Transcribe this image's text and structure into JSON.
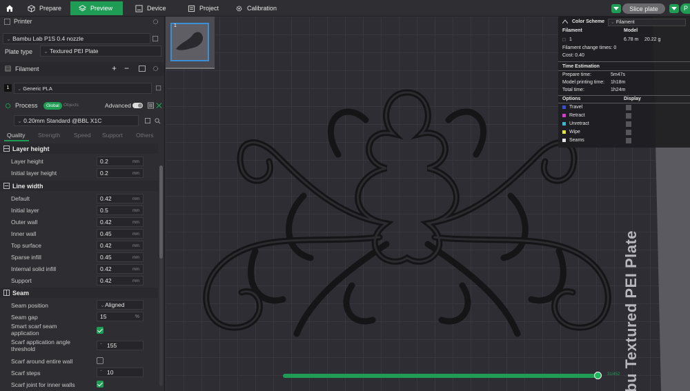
{
  "topbar": {
    "tabs": [
      {
        "label": "Prepare"
      },
      {
        "label": "Preview"
      },
      {
        "label": "Device"
      },
      {
        "label": "Project"
      },
      {
        "label": "Calibration"
      }
    ],
    "slice_label": "Slice plate",
    "print_label": "P"
  },
  "printer": {
    "section_label": "Printer",
    "name": "Bambu Lab P1S 0.4 nozzle",
    "plate_type_label": "Plate type",
    "plate_type": "Textured PEI Plate"
  },
  "filament": {
    "section_label": "Filament",
    "slot": "1",
    "name": "Generic PLA"
  },
  "process": {
    "section_label": "Process",
    "global_label": "Global",
    "objects_label": "Objects",
    "advanced_label": "Advanced",
    "preset": "0.20mm Standard @BBL X1C",
    "subtabs": [
      "Quality",
      "Strength",
      "Speed",
      "Support",
      "Others"
    ]
  },
  "settings": {
    "layer_height": {
      "title": "Layer height",
      "rows": [
        {
          "label": "Layer height",
          "value": "0.2",
          "unit": "mm"
        },
        {
          "label": "Initial layer height",
          "value": "0.2",
          "unit": "mm"
        }
      ]
    },
    "line_width": {
      "title": "Line width",
      "rows": [
        {
          "label": "Default",
          "value": "0.42",
          "unit": "mm"
        },
        {
          "label": "Initial layer",
          "value": "0.5",
          "unit": "mm"
        },
        {
          "label": "Outer wall",
          "value": "0.42",
          "unit": "mm"
        },
        {
          "label": "Inner wall",
          "value": "0.45",
          "unit": "mm"
        },
        {
          "label": "Top surface",
          "value": "0.42",
          "unit": "mm"
        },
        {
          "label": "Sparse infill",
          "value": "0.45",
          "unit": "mm"
        },
        {
          "label": "Internal solid infill",
          "value": "0.42",
          "unit": "mm"
        },
        {
          "label": "Support",
          "value": "0.42",
          "unit": "mm"
        }
      ]
    },
    "seam": {
      "title": "Seam",
      "seam_position_label": "Seam position",
      "seam_position": "Aligned",
      "seam_gap_label": "Seam gap",
      "seam_gap": "15",
      "seam_gap_unit": "%",
      "smart_scarf_label_1": "Smart scarf seam",
      "smart_scarf_label_2": "application",
      "smart_scarf": true,
      "scarf_angle_label_1": "Scarf application angle",
      "scarf_angle_label_2": "threshold",
      "scarf_angle": "155",
      "scarf_entire_label": "Scarf around entire wall",
      "scarf_entire": false,
      "scarf_steps_label": "Scarf steps",
      "scarf_steps": "10",
      "scarf_inner_label": "Scarf joint for inner walls",
      "scarf_inner": true
    }
  },
  "viewport": {
    "plate_number": "1",
    "plate_text": "bu Textured PEI Plate",
    "layer_readout": "31/452"
  },
  "legend": {
    "color_scheme_label": "Color Scheme",
    "color_scheme": "Filament",
    "filament_header": "Filament",
    "model_header": "Model",
    "filament_slot": "1",
    "filament_length": "6.78 m",
    "filament_weight": "20.22 g",
    "change_times_label": "Filament change times:",
    "change_times": "0",
    "cost_label": "Cost:",
    "cost": "0.40",
    "time_estimation_label": "Time Estimation",
    "prepare_time_label": "Prepare time:",
    "prepare_time": "5m47s",
    "model_time_label": "Model printing time:",
    "model_time": "1h18m",
    "total_time_label": "Total time:",
    "total_time": "1h24m",
    "options_label": "Options",
    "display_label": "Display",
    "options": [
      {
        "label": "Travel",
        "color": "#3b4fd6"
      },
      {
        "label": "Retract",
        "color": "#d63bd0"
      },
      {
        "label": "Unretract",
        "color": "#3bb8d6"
      },
      {
        "label": "Wipe",
        "color": "#e6e63b"
      },
      {
        "label": "Seams",
        "color": "#e6e6e6"
      }
    ]
  },
  "colors": {
    "accent": "#1f9d55",
    "selection": "#3b8fd6"
  }
}
